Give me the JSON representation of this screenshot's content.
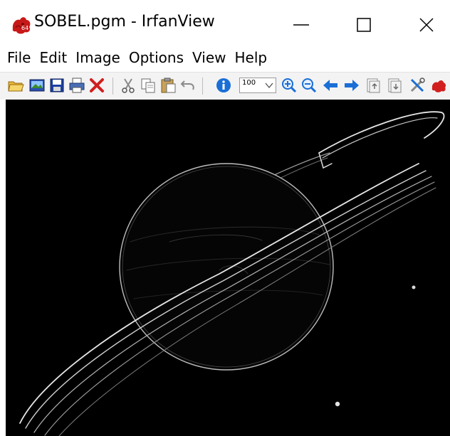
{
  "window": {
    "title": "SOBEL.pgm - IrfanView",
    "app_icon": "irfanview-red-cat-icon"
  },
  "controls": {
    "minimize_icon": "minimize-icon",
    "maximize_icon": "maximize-icon",
    "close_icon": "close-icon"
  },
  "menu": {
    "items": [
      {
        "label": "File"
      },
      {
        "label": "Edit"
      },
      {
        "label": "Image"
      },
      {
        "label": "Options"
      },
      {
        "label": "View"
      },
      {
        "label": "Help"
      }
    ]
  },
  "toolbar": {
    "zoom_value": "100",
    "buttons": [
      {
        "icon": "open-folder-icon"
      },
      {
        "icon": "slideshow-icon"
      },
      {
        "icon": "save-icon"
      },
      {
        "icon": "print-icon"
      },
      {
        "icon": "delete-icon"
      },
      {
        "icon": "cut-icon"
      },
      {
        "icon": "copy-icon"
      },
      {
        "icon": "paste-icon"
      },
      {
        "icon": "undo-icon"
      },
      {
        "icon": "info-icon"
      },
      {
        "icon": "zoom-in-icon"
      },
      {
        "icon": "zoom-out-icon"
      },
      {
        "icon": "previous-icon"
      },
      {
        "icon": "next-icon"
      },
      {
        "icon": "first-page-icon"
      },
      {
        "icon": "last-page-icon"
      },
      {
        "icon": "properties-icon"
      },
      {
        "icon": "about-icon"
      }
    ]
  },
  "colors": {
    "canvas_background": "#000000",
    "toolbar_background": "#f3f3f3",
    "accent_blue": "#1a6fd6",
    "irfan_red": "#d11f1f"
  }
}
